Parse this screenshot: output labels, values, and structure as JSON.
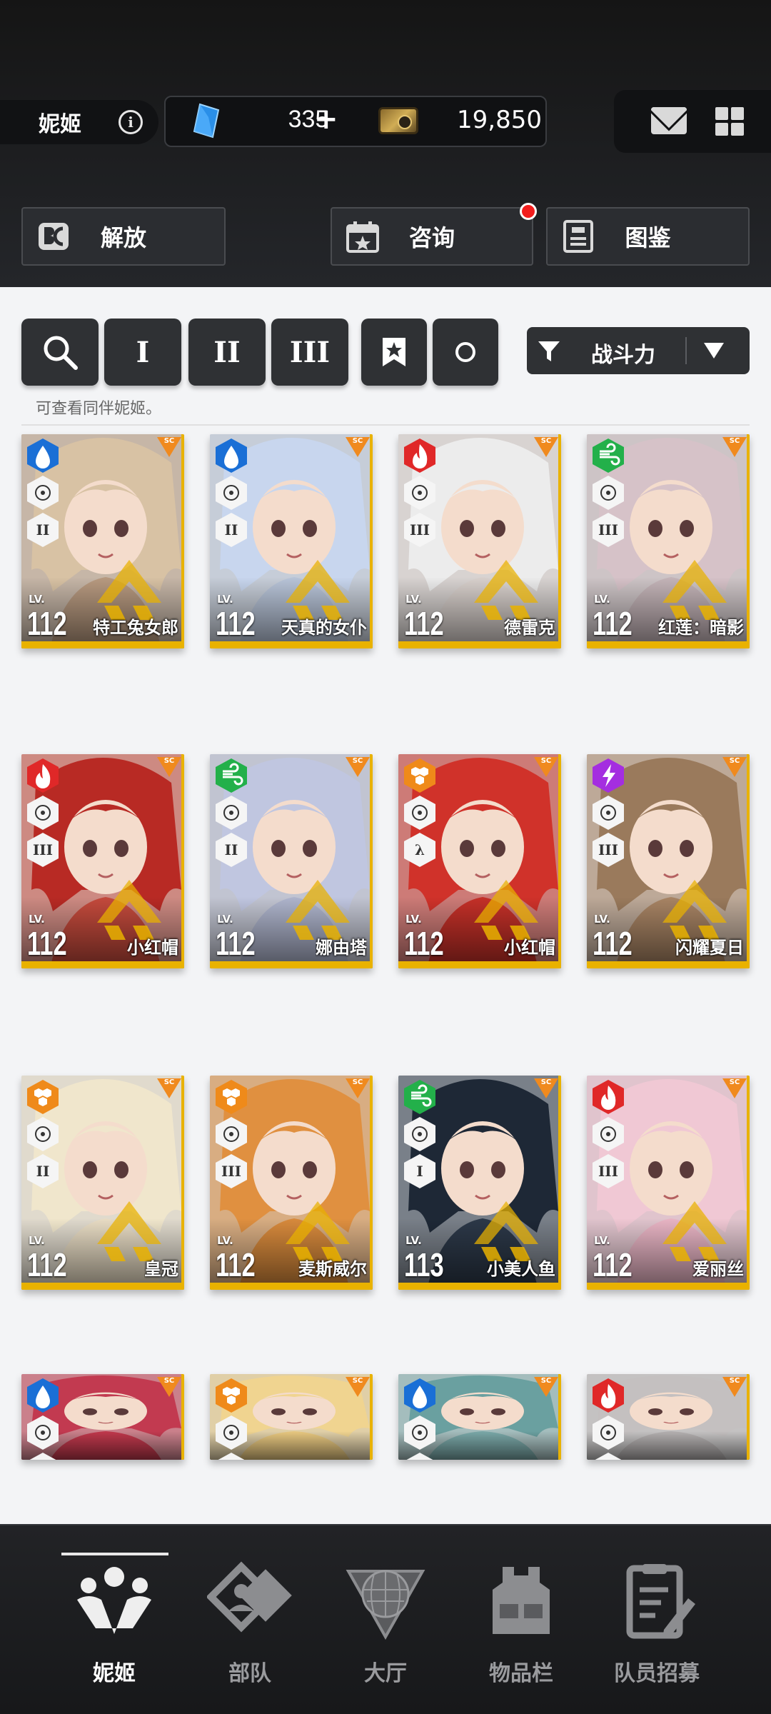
{
  "header": {
    "title": "妮姬",
    "info_icon": "info-icon",
    "gem_value": "335",
    "gem_plus": "+",
    "credit_value": "19,850",
    "icons": [
      "gem-icon",
      "credit-icon",
      "mail-icon",
      "grid-menu-icon"
    ]
  },
  "actions": {
    "liberate": "解放",
    "consult": "咨询",
    "codex": "图鉴",
    "consult_notification": true
  },
  "filters": {
    "buttons": [
      "search-icon",
      "I",
      "II",
      "III",
      "bookmark-icon",
      "circle-icon"
    ],
    "I": "I",
    "II": "II",
    "III": "III",
    "sort_label": "战斗力",
    "hint": "可查看同伴妮姬。"
  },
  "cards": [
    {
      "name": "特工兔女郎",
      "level": "112",
      "element": "water",
      "class": "II",
      "portrait": "#b89a80",
      "hair": "#d8c2a4"
    },
    {
      "name": "天真的女仆",
      "level": "112",
      "element": "water",
      "class": "II",
      "portrait": "#b8c4d8",
      "hair": "#c8d6ee"
    },
    {
      "name": "德雷克",
      "level": "112",
      "element": "fire",
      "class": "III",
      "portrait": "#d8d0cc",
      "hair": "#ececec"
    },
    {
      "name": "红莲：暗影",
      "level": "112",
      "element": "wind",
      "class": "III",
      "portrait": "#c4b4b8",
      "hair": "#d6c2c8"
    },
    {
      "name": "小红帽",
      "level": "112",
      "element": "fire",
      "class": "III",
      "portrait": "#c44a3c",
      "hair": "#b82a24"
    },
    {
      "name": "娜由塔",
      "level": "112",
      "element": "wind",
      "class": "II",
      "portrait": "#aeb4cc",
      "hair": "#c0c6e0"
    },
    {
      "name": "小红帽",
      "level": "112",
      "element": "iron",
      "class": "λ",
      "portrait": "#c43028",
      "hair": "#d0322a"
    },
    {
      "name": "闪耀夏日",
      "level": "112",
      "element": "electric",
      "class": "III",
      "portrait": "#a88464",
      "hair": "#9a7a5c"
    },
    {
      "name": "皇冠",
      "level": "112",
      "element": "iron",
      "class": "II",
      "portrait": "#e8dcc4",
      "hair": "#f0e6cc"
    },
    {
      "name": "麦斯威尔",
      "level": "112",
      "element": "iron",
      "class": "III",
      "portrait": "#d88a3c",
      "hair": "#e09040"
    },
    {
      "name": "小美人鱼",
      "level": "113",
      "element": "wind",
      "class": "I",
      "portrait": "#2c3848",
      "hair": "#1e2836"
    },
    {
      "name": "爱丽丝",
      "level": "112",
      "element": "fire",
      "class": "III",
      "portrait": "#e8b4c4",
      "hair": "#f0c8d4"
    },
    {
      "name": "",
      "level": "",
      "element": "water",
      "class": "II",
      "portrait": "#c0384c",
      "hair": "#c23a50"
    },
    {
      "name": "",
      "level": "",
      "element": "iron",
      "class": "I",
      "portrait": "#e8c880",
      "hair": "#f0d490"
    },
    {
      "name": "",
      "level": "",
      "element": "water",
      "class": "III",
      "portrait": "#7aa8a8",
      "hair": "#6aa0a0"
    },
    {
      "name": "",
      "level": "",
      "element": "fire",
      "class": "III",
      "portrait": "#b4b0b0",
      "hair": "#c4c0c0"
    }
  ],
  "element_colors": {
    "water": "#1a6fd6",
    "fire": "#e02828",
    "wind": "#23b04a",
    "iron": "#ef8a1a",
    "electric": "#a42ee0"
  },
  "nav": {
    "items": [
      "妮姬",
      "部队",
      "大厅",
      "物品栏",
      "队员招募"
    ],
    "active": "妮姬"
  }
}
